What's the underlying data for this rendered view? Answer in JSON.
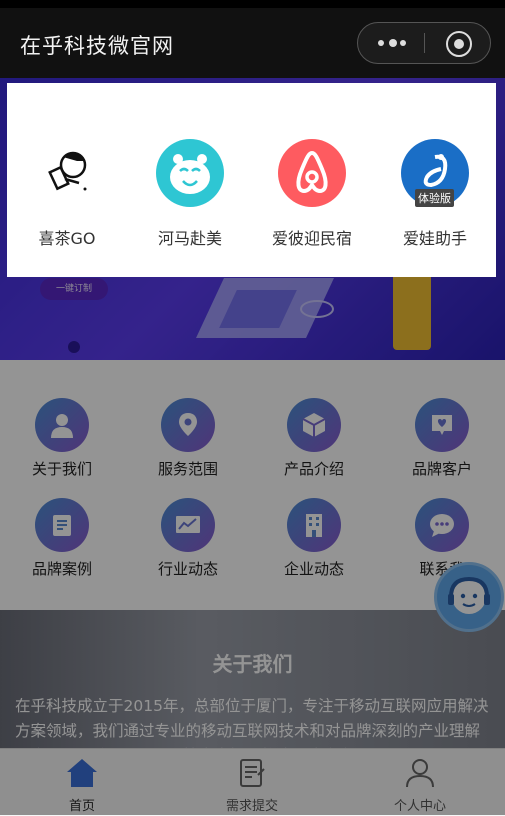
{
  "navbar": {
    "title": "在乎科技微官网"
  },
  "banner": {
    "button_label": "一键订制"
  },
  "grid": [
    {
      "label": "关于我们",
      "icon": "user-icon"
    },
    {
      "label": "服务范围",
      "icon": "location-pin-icon"
    },
    {
      "label": "产品介绍",
      "icon": "box-icon"
    },
    {
      "label": "品牌客户",
      "icon": "heart-chat-icon"
    },
    {
      "label": "品牌案例",
      "icon": "clipboard-icon"
    },
    {
      "label": "行业动态",
      "icon": "chart-icon"
    },
    {
      "label": "企业动态",
      "icon": "building-icon"
    },
    {
      "label": "联系我",
      "icon": "chat-bubble-icon"
    }
  ],
  "about": {
    "title": "关于我们",
    "text": "在乎科技成立于2015年，总部位于厦门，专注于移动互联网应用解决方案领域，我们通过专业的移动互联网技术和对品牌深刻的产业理解为企业提供移动互联网+技术支持与整体解决方案"
  },
  "tabbar": [
    {
      "label": "首页",
      "icon": "home-icon"
    },
    {
      "label": "需求提交",
      "icon": "edit-icon"
    },
    {
      "label": "个人中心",
      "icon": "person-icon"
    }
  ],
  "popup": {
    "apps": [
      {
        "label": "喜茶GO",
        "icon": "heytea-logo"
      },
      {
        "label": "河马赴美",
        "icon": "hippo-logo"
      },
      {
        "label": "爱彼迎民宿",
        "icon": "airbnb-logo"
      },
      {
        "label": "爱娃助手",
        "icon": "aiwa-logo",
        "badge": "体验版"
      }
    ]
  },
  "colors": {
    "accent": "#3f6fd0",
    "tab_active": "#3a6fd8",
    "icon_gradient_start": "#4a8fd6",
    "icon_gradient_end": "#8a5bd0"
  }
}
